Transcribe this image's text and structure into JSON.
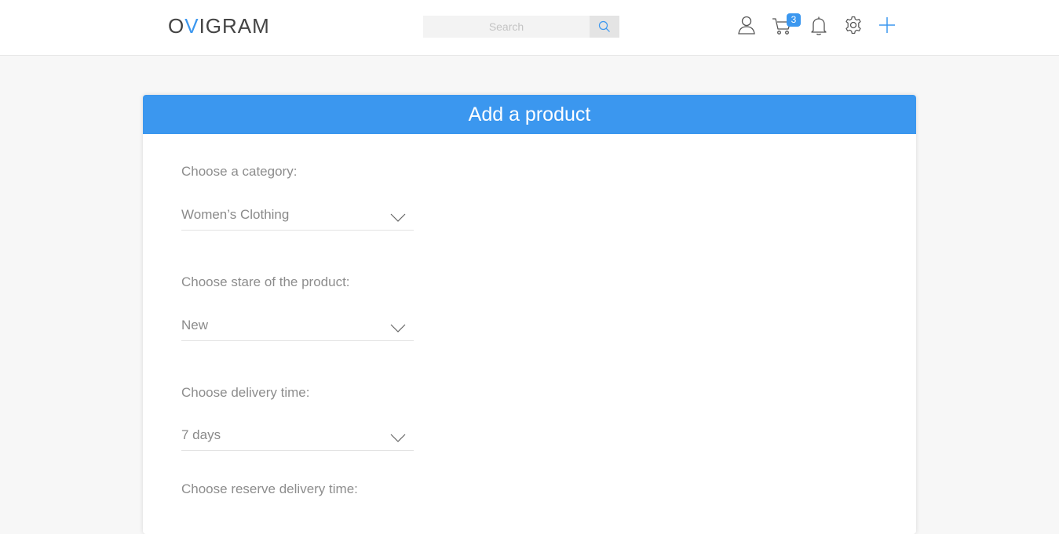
{
  "header": {
    "logo_prefix": "O",
    "logo_accent": "V",
    "logo_suffix": "IGRAM",
    "search_placeholder": "Search",
    "cart_count": "3",
    "accent_color": "#3b97ef"
  },
  "form": {
    "title": "Add a product",
    "fields": [
      {
        "label": "Choose a category:",
        "value": "Women’s Clothing"
      },
      {
        "label": "Choose stare of the product:",
        "value": "New"
      },
      {
        "label": "Choose delivery time:",
        "value": "7 days"
      },
      {
        "label": "Choose reserve delivery time:"
      }
    ]
  }
}
